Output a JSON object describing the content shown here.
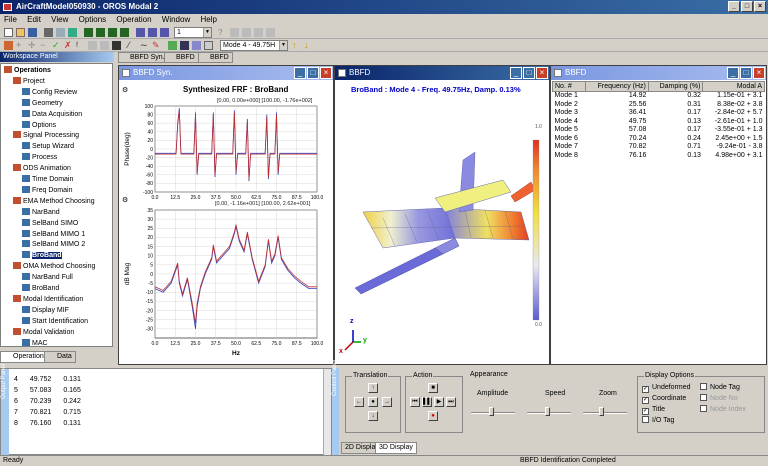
{
  "app": {
    "title": "AirCraftModel050930 - OROS Modal 2"
  },
  "menu": [
    "File",
    "Edit",
    "View",
    "Options",
    "Operation",
    "Window",
    "Help"
  ],
  "toolbar": {
    "combo1": "1",
    "mode_combo": "Mode  4 - 49.75H"
  },
  "workspace": {
    "title": "Workspace Panel",
    "tree": [
      {
        "label": "Operations",
        "level": 0,
        "bold": true
      },
      {
        "label": "Project",
        "level": 1
      },
      {
        "label": "Config Review",
        "level": 2
      },
      {
        "label": "Geometry",
        "level": 2
      },
      {
        "label": "Data Acquisition",
        "level": 2
      },
      {
        "label": "Options",
        "level": 2
      },
      {
        "label": "Signal Processing",
        "level": 1
      },
      {
        "label": "Setup Wizard",
        "level": 2
      },
      {
        "label": "Process",
        "level": 2
      },
      {
        "label": "ODS Animation",
        "level": 1
      },
      {
        "label": "Time Domain",
        "level": 2
      },
      {
        "label": "Freq Domain",
        "level": 2
      },
      {
        "label": "EMA Method Choosing",
        "level": 1
      },
      {
        "label": "NarBand",
        "level": 2
      },
      {
        "label": "SelBand SIMO",
        "level": 2
      },
      {
        "label": "SelBand MIMO 1",
        "level": 2
      },
      {
        "label": "SelBand MIMO 2",
        "level": 2
      },
      {
        "label": "BroBand",
        "level": 2,
        "selected": true
      },
      {
        "label": "OMA Method Choosing",
        "level": 1
      },
      {
        "label": "NarBand Full",
        "level": 2
      },
      {
        "label": "BroBand",
        "level": 2
      },
      {
        "label": "Modal Identification",
        "level": 1
      },
      {
        "label": "Display MIF",
        "level": 2
      },
      {
        "label": "Start Identification",
        "level": 2
      },
      {
        "label": "Modal Validation",
        "level": 1
      },
      {
        "label": "MAC",
        "level": 2
      }
    ],
    "tabs": [
      "Operation",
      "Data"
    ]
  },
  "doc_tabs": [
    "BBFD Syn.",
    "BBFD",
    "BBFD"
  ],
  "syn_window": {
    "title": "BBFD Syn.",
    "plot_title": "Synthesized FRF : BroBand",
    "top_info": "[0.00, 0.00e+000] [100.00, -1.76e+002]",
    "bottom_info": "[0.00, -1.16e+001] [100.00, 2.62e+001]",
    "top_ylabel": "Phase(deg)",
    "bottom_ylabel": "dB Mag",
    "xlabel": "Hz"
  },
  "chart_data": [
    {
      "type": "line",
      "title": "Synthesized FRF : BroBand",
      "xlabel": "",
      "ylabel": "Phase(deg)",
      "xlim": [
        0,
        100
      ],
      "ylim": [
        -100,
        100
      ],
      "xticks": [
        0,
        12.5,
        25,
        37.5,
        50,
        62.5,
        75,
        87.5,
        100
      ],
      "xtick_labels": [
        "0.0",
        "12.5",
        "25.0",
        "37.5",
        "50.0",
        "62.5",
        "75.0",
        "87.5",
        "100.0"
      ],
      "yticks": [
        -100,
        -80,
        -60,
        -40,
        -20,
        0,
        20,
        40,
        60,
        80,
        100
      ],
      "ytick_labels": [
        "-100",
        "-80",
        "-60",
        "-40",
        "-20",
        "0",
        "20",
        "40",
        "60",
        "80",
        "100"
      ],
      "series": [
        {
          "color": "#3040c0",
          "x": [
            0,
            13,
            14,
            15,
            16,
            24,
            25,
            26,
            27,
            35,
            36,
            37,
            38,
            48,
            49,
            50,
            51,
            56,
            57,
            58,
            59,
            68,
            69,
            70,
            71,
            74,
            75,
            76,
            77,
            81,
            82,
            100
          ],
          "y": [
            -10,
            -10,
            60,
            95,
            -10,
            -10,
            85,
            -60,
            -10,
            -10,
            85,
            -65,
            -10,
            -10,
            90,
            -60,
            -10,
            -10,
            70,
            -75,
            -10,
            -10,
            80,
            -70,
            -10,
            -10,
            85,
            -60,
            -10,
            -10,
            -10,
            -10
          ]
        },
        {
          "color": "#c03030",
          "x": [
            0,
            13,
            14,
            15,
            16,
            24,
            25,
            26,
            27,
            35,
            36,
            37,
            38,
            48,
            49,
            50,
            51,
            56,
            57,
            58,
            59,
            68,
            69,
            70,
            71,
            74,
            75,
            76,
            77,
            81,
            82,
            100
          ],
          "y": [
            -12,
            -12,
            55,
            90,
            -12,
            -12,
            80,
            -55,
            -12,
            -12,
            80,
            -60,
            -12,
            -12,
            85,
            -55,
            -12,
            -12,
            65,
            -70,
            -12,
            -12,
            75,
            -65,
            -12,
            -12,
            80,
            -55,
            -12,
            -12,
            -12,
            -12
          ]
        }
      ]
    },
    {
      "type": "line",
      "title": "",
      "xlabel": "Hz",
      "ylabel": "dB Mag",
      "xlim": [
        0,
        100
      ],
      "ylim": [
        -35,
        35
      ],
      "xticks": [
        0,
        12.5,
        25,
        37.5,
        50,
        62.5,
        75,
        87.5,
        100
      ],
      "xtick_labels": [
        "0.0",
        "12.5",
        "25.0",
        "37.5",
        "50.0",
        "62.5",
        "75.0",
        "87.5",
        "100.0"
      ],
      "yticks": [
        -30,
        -25,
        -20,
        -15,
        -10,
        -5,
        0,
        5,
        10,
        15,
        20,
        25,
        30,
        35
      ],
      "ytick_labels": [
        "-30",
        "-25",
        "-20",
        "-15",
        "-10",
        "-5",
        "0",
        "5",
        "10",
        "15",
        "20",
        "25",
        "30",
        "35"
      ],
      "series": [
        {
          "color": "#3040c0",
          "x": [
            0,
            5,
            10,
            14,
            15,
            17,
            20,
            23,
            25,
            26,
            28,
            31,
            35,
            36,
            38,
            42,
            46,
            49,
            50,
            52,
            55,
            57,
            60,
            64,
            68,
            70,
            72,
            74,
            76,
            78,
            82,
            86,
            90,
            95,
            100
          ],
          "y": [
            -8,
            -10,
            -5,
            5,
            -5,
            -12,
            -3,
            -18,
            -30,
            -18,
            -8,
            0,
            8,
            15,
            6,
            10,
            14,
            22,
            26,
            18,
            12,
            22,
            8,
            -5,
            4,
            18,
            6,
            10,
            20,
            8,
            2,
            -2,
            -5,
            -8,
            -8
          ]
        },
        {
          "color": "#c03030",
          "x": [
            0,
            5,
            10,
            14,
            15,
            17,
            20,
            23,
            25,
            26,
            28,
            31,
            35,
            36,
            38,
            42,
            46,
            49,
            50,
            52,
            55,
            57,
            60,
            64,
            68,
            70,
            72,
            74,
            76,
            78,
            82,
            86,
            90,
            95,
            100
          ],
          "y": [
            -7,
            -9,
            -4,
            6,
            -4,
            -11,
            -2,
            -16,
            -27,
            -16,
            -7,
            1,
            9,
            16,
            7,
            11,
            15,
            23,
            27,
            19,
            13,
            23,
            9,
            -4,
            5,
            19,
            7,
            11,
            21,
            9,
            3,
            -1,
            -4,
            -7,
            -7
          ]
        }
      ]
    }
  ],
  "view3d": {
    "title": "BBFD",
    "header": "BroBand : Mode  4 - Freq. 49.75Hz, Damp.  0.13%",
    "scale_max": "1.0",
    "scale_min": "0.0",
    "axes": [
      "x",
      "y",
      "z"
    ]
  },
  "modes_window": {
    "title": "BBFD",
    "columns": [
      "No. #",
      "Frequency (Hz)",
      "Damping (%)",
      "Modal A"
    ],
    "rows": [
      [
        "Mode  1",
        "14.92",
        "0.32",
        "1.15e-01 + 3.1"
      ],
      [
        "Mode  2",
        "25.56",
        "0.31",
        "8.38e-02 + 3.8"
      ],
      [
        "Mode  3",
        "36.41",
        "0.17",
        "-2.84e-02 + 5.7"
      ],
      [
        "Mode  4",
        "49.75",
        "0.13",
        "-2.61e-01 + 1.0"
      ],
      [
        "Mode  5",
        "57.08",
        "0.17",
        "-3.55e-01 + 1.3"
      ],
      [
        "Mode  6",
        "70.24",
        "0.24",
        "2.45e+00 + 1.5"
      ],
      [
        "Mode  7",
        "70.82",
        "0.71",
        "-9.24e-01 - 3.8"
      ],
      [
        "Mode  8",
        "76.16",
        "0.13",
        "4.98e+00 + 3.1"
      ]
    ]
  },
  "data_list": {
    "rows": [
      [
        "4",
        "49.752",
        "0.131"
      ],
      [
        "5",
        "57.083",
        "0.165"
      ],
      [
        "6",
        "70.239",
        "0.242"
      ],
      [
        "7",
        "70.821",
        "0.715"
      ],
      [
        "8",
        "76.160",
        "0.131"
      ]
    ],
    "side_tab": "Output Panel"
  },
  "control_panel": {
    "side_tab": "Control Panel",
    "translation_label": "Translation",
    "action_label": "Action",
    "appearance_label": "Appearance",
    "amplitude_label": "Amplitude",
    "speed_label": "Speed",
    "zoom_label": "Zoom",
    "display_options_label": "Display Options",
    "options": [
      {
        "label": "Undeformed",
        "checked": true,
        "enabled": true
      },
      {
        "label": "Coordinate",
        "checked": true,
        "enabled": true
      },
      {
        "label": "Title",
        "checked": true,
        "enabled": true
      },
      {
        "label": "I/O Tag",
        "checked": false,
        "enabled": true
      },
      {
        "label": "Node Tag",
        "checked": false,
        "enabled": true
      },
      {
        "label": "Node No",
        "checked": false,
        "enabled": false
      },
      {
        "label": "Node Index",
        "checked": false,
        "enabled": false
      }
    ],
    "tabs": [
      "2D Display",
      "3D Display"
    ]
  },
  "status": {
    "left": "Ready",
    "center": "BBFD Identification Completed"
  }
}
